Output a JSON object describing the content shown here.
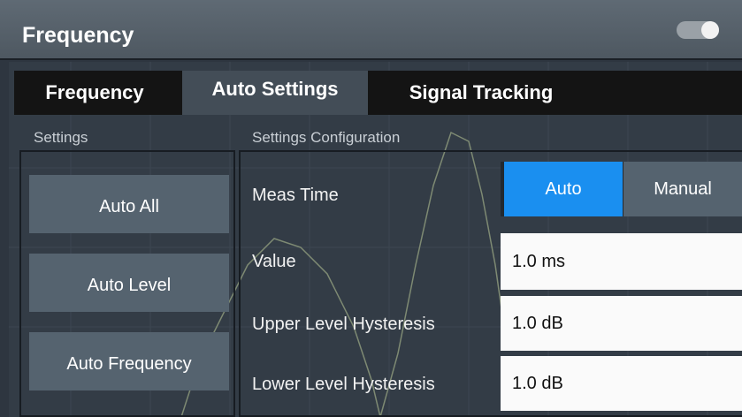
{
  "dialog": {
    "title": "Frequency"
  },
  "tabs": [
    {
      "label": "Frequency",
      "active": false
    },
    {
      "label": "Auto Settings",
      "active": true
    },
    {
      "label": "Signal Tracking",
      "active": false
    }
  ],
  "settings_group": {
    "label": "Settings",
    "buttons": [
      {
        "label": "Auto All"
      },
      {
        "label": "Auto Level"
      },
      {
        "label": "Auto Frequency"
      }
    ]
  },
  "config_group": {
    "label": "Settings Configuration",
    "meas_time": {
      "label": "Meas Time",
      "options": [
        "Auto",
        "Manual"
      ],
      "selected": "Auto"
    },
    "value": {
      "label": "Value",
      "value": "1.0 ms"
    },
    "upper_hysteresis": {
      "label": "Upper Level Hysteresis",
      "value": "1.0 dB"
    },
    "lower_hysteresis": {
      "label": "Lower Level Hysteresis",
      "value": "1.0 dB"
    }
  },
  "colors": {
    "accent": "#1a8ff0",
    "background": "#2e3640",
    "button": "#55636f",
    "tab_bar": "#141414"
  }
}
